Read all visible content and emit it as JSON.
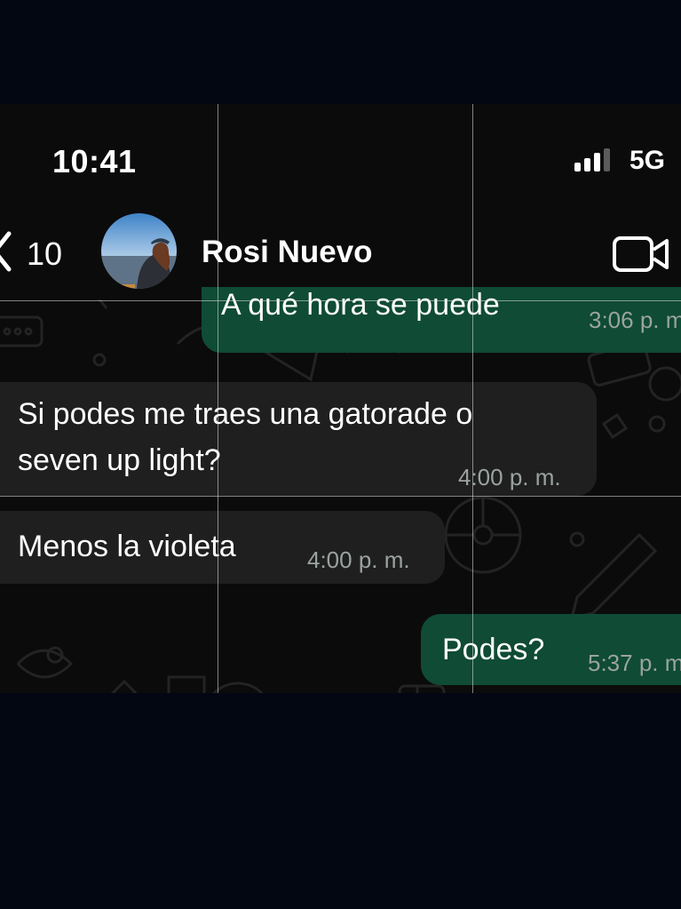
{
  "status_bar": {
    "time": "10:41",
    "network": "5G"
  },
  "header": {
    "back_count": "10",
    "contact_name": "Rosi Nuevo"
  },
  "messages": [
    {
      "direction": "outgoing",
      "text": "A qué hora se puede",
      "time": "3:06 p. m."
    },
    {
      "direction": "incoming",
      "lines": [
        "Si podes me traes una gatorade o",
        "seven up light?"
      ],
      "time": "4:00 p. m."
    },
    {
      "direction": "incoming",
      "text": "Menos la violeta",
      "time": "4:00 p. m."
    },
    {
      "direction": "outgoing",
      "text": "Podes?",
      "time": "5:37 p. m."
    }
  ],
  "colors": {
    "outgoing_bubble": "#0f4b35",
    "incoming_bubble": "#1f1f1f",
    "chat_background": "#0b0b0b",
    "timestamp": "#9aa3a0"
  },
  "icons": [
    "signal-bars-icon",
    "back-chevron-icon",
    "video-call-icon"
  ]
}
